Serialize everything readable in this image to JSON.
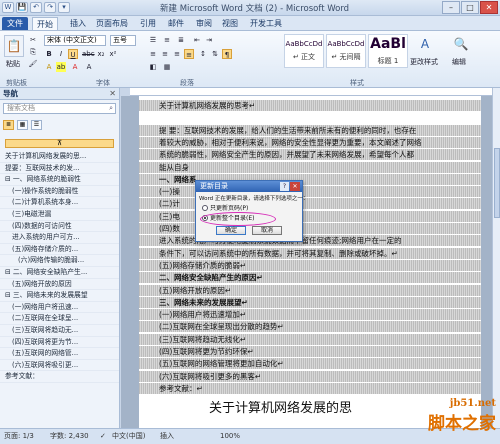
{
  "window": {
    "title": "新建 Microsoft Word 文档 (2) - Microsoft Word",
    "qat": [
      "W",
      "💾",
      "↶",
      "↷",
      "▾"
    ],
    "controls": [
      "–",
      "□",
      "✕"
    ]
  },
  "tabs": [
    "文件",
    "开始",
    "插入",
    "页面布局",
    "引用",
    "邮件",
    "审阅",
    "视图",
    "开发工具"
  ],
  "ribbon": {
    "clipboard": {
      "paste": "粘贴",
      "label": "剪贴板"
    },
    "font": {
      "name": "宋体 (中文正文)",
      "size": "五号",
      "label": "字体"
    },
    "paragraph": {
      "label": "段落"
    },
    "styles": {
      "items": [
        {
          "sample": "AaBbCcDd",
          "name": "↵ 正文"
        },
        {
          "sample": "AaBbCcDd",
          "name": "↵ 无间隔"
        },
        {
          "sample": "AaBl",
          "name": "标题 1"
        }
      ],
      "change_styles": "更改样式",
      "label": "样式"
    },
    "editing": {
      "label": "编辑"
    }
  },
  "nav": {
    "title": "导航",
    "search_placeholder": "搜索文档",
    "collapse_symbol": "⊼",
    "items": [
      {
        "text": "关于计算机网络发展的思...",
        "level": 1
      },
      {
        "text": "提要：互联网技术的发...",
        "level": 1
      },
      {
        "text": "⊟ 一、网络系统的脆弱性",
        "level": 1
      },
      {
        "text": "(一)操作系统的脆弱性",
        "level": 2
      },
      {
        "text": "(二)计算机系统本身...",
        "level": 2
      },
      {
        "text": "(三)电磁泄漏",
        "level": 2
      },
      {
        "text": "(四)数据的可访问性",
        "level": 2
      },
      {
        "text": "进入系统的用户可方...",
        "level": 2
      },
      {
        "text": "(五)网络存储介质的...",
        "level": 2
      },
      {
        "text": "(六)网络传输的脆弱...",
        "level": 3
      },
      {
        "text": "⊟ 二、网络安全缺陷产生...",
        "level": 1
      },
      {
        "text": "(五)网络开放的原因",
        "level": 2
      },
      {
        "text": "⊟ 三、网络未来的发展展望",
        "level": 1
      },
      {
        "text": "(一)网络用户将迅速...",
        "level": 2
      },
      {
        "text": "(二)互联网在全球呈...",
        "level": 2
      },
      {
        "text": "(三)互联网将趋动无...",
        "level": 2
      },
      {
        "text": "(四)互联网将更为节...",
        "level": 2
      },
      {
        "text": "(五)互联网的网络管...",
        "level": 2
      },
      {
        "text": "(六)互联网将吸引更...",
        "level": 2
      },
      {
        "text": "参考文献：",
        "level": 1
      }
    ]
  },
  "document": {
    "lines": [
      {
        "text": "关于计算机网络发展的思考↵",
        "hl": true,
        "bold": false
      },
      {
        "text": "",
        "hl": false,
        "bold": false
      },
      {
        "text": "提 要：互联网技术的发展，给人们的生活带来前所未有的便利的同时，也存在",
        "hl": true,
        "bold": false
      },
      {
        "text": "着较大的威胁，相对于便利来说，网络的安全性显得更为重要，本文阐述了网络",
        "hl": true,
        "bold": false
      },
      {
        "text": "系统的脆弱性，网络安全产生的原因，并展望了未来网络发展，希望每个人都",
        "hl": true,
        "bold": false
      },
      {
        "text": "能从自身",
        "hl": true,
        "bold": false
      },
      {
        "text": "一、网络系",
        "hl": true,
        "bold": true
      },
      {
        "text": "(一)操",
        "hl": true,
        "bold": false
      },
      {
        "text": "(二)计",
        "hl": true,
        "bold": false
      },
      {
        "text": "(三)电",
        "hl": true,
        "bold": false
      },
      {
        "text": "(四)数",
        "hl": true,
        "bold": false
      },
      {
        "text": "进入系统的用户可方便地复制系统数据而不留任何痕迹;网络用户在一定的",
        "hl": true,
        "bold": false
      },
      {
        "text": "条件下，可以访问系统中的所有数据，并可将其复制、删除或破坏掉。↵",
        "hl": true,
        "bold": false
      },
      {
        "text": "(五)网络存储介质的脆弱↵",
        "hl": true,
        "bold": false
      },
      {
        "text": "二、网络安全缺陷产生的原因↵",
        "hl": true,
        "bold": true
      },
      {
        "text": "(五)网络开放的原因↵",
        "hl": true,
        "bold": false
      },
      {
        "text": "三、网络未来的发展展望↵",
        "hl": true,
        "bold": true
      },
      {
        "text": "(一)网络用户将迅速增加↵",
        "hl": true,
        "bold": false
      },
      {
        "text": "(二)互联网在全球呈现出分散的趋势↵",
        "hl": true,
        "bold": false
      },
      {
        "text": "(三)互联网将趋动无线化↵",
        "hl": true,
        "bold": false
      },
      {
        "text": "(四)互联网将更为节约环保↵",
        "hl": true,
        "bold": false
      },
      {
        "text": "(五)互联网的网络管理将更加自动化↵",
        "hl": true,
        "bold": false
      },
      {
        "text": "(六)互联网将吸引更多的黑客↵",
        "hl": true,
        "bold": false
      },
      {
        "text": "参考文献：↵",
        "hl": true,
        "bold": false
      }
    ],
    "footer_title": "关于计算机网络发展的思"
  },
  "dialog": {
    "title": "更新目录",
    "help": "?",
    "close": "✕",
    "message": "Word 正在更新目录，请选择下列选项之一：",
    "option1": "只更新页码(P)",
    "option2": "更新整个目录(E)",
    "ok": "确定",
    "cancel": "取消",
    "selected": "option2"
  },
  "status": {
    "page": "页面: 1/3",
    "words": "字数: 2,430",
    "lang": "中文(中国)",
    "mode": "插入",
    "zoom": "100%"
  },
  "watermark": {
    "url": "jb51.net",
    "name": "脚本之家"
  },
  "colors": {
    "highlight_ellipse": "#d62db8",
    "file_tab": "#2a5caa",
    "watermark": "#e07000"
  }
}
